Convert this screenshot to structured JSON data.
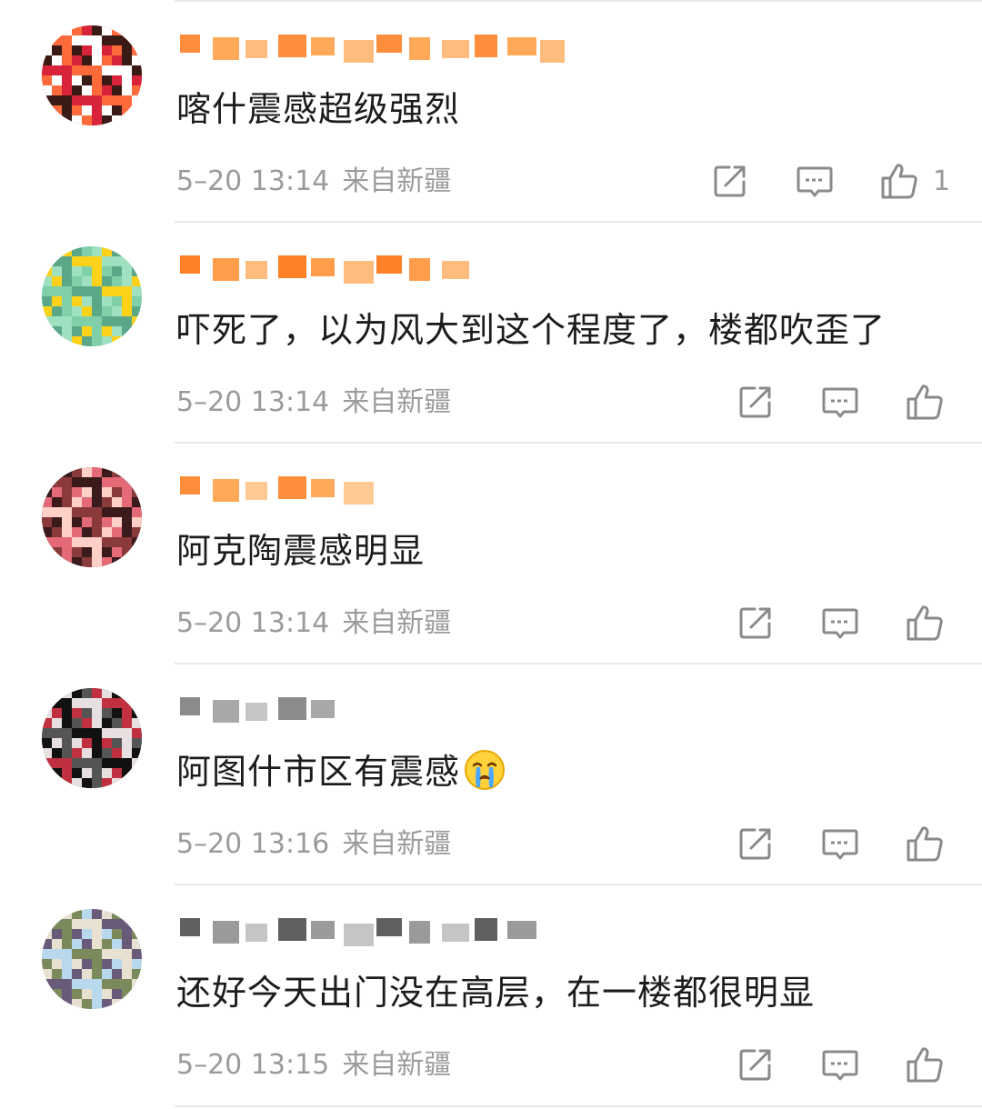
{
  "comments": [
    {
      "text": "喀什震感超级强烈",
      "time": "5-20 13:14",
      "source": "来自新疆",
      "likes": "1",
      "username_colors": [
        "#ff7a1a",
        "#ff9a3c",
        "#ffb066"
      ],
      "avatar_colors": [
        "#d8243a",
        "#ff6a3a",
        "#ffffff",
        "#3a1a14"
      ]
    },
    {
      "text": "吓死了，以为风大到这个程度了，楼都吹歪了",
      "time": "5-20 13:14",
      "source": "来自新疆",
      "likes": "",
      "username_colors": [
        "#ff6a00",
        "#ff8c2a",
        "#ffb066"
      ],
      "avatar_colors": [
        "#9fe0c0",
        "#7fcfa8",
        "#5aa888",
        "#ffd21a"
      ]
    },
    {
      "text": "阿克陶震感明显",
      "time": "5-20 13:14",
      "source": "来自新疆",
      "likes": "",
      "username_colors": [
        "#ff7a1a",
        "#ff9a3c",
        "#ffc080"
      ],
      "avatar_colors": [
        "#3a1a1a",
        "#e46a78",
        "#ffd0c8",
        "#8a3a3a"
      ]
    },
    {
      "text": "阿图什市区有震感",
      "emoji": "crying-face",
      "time": "5-20 13:16",
      "source": "来自新疆",
      "likes": "",
      "username_colors": [
        "#777777",
        "#999999",
        "#bbbbbb"
      ],
      "avatar_colors": [
        "#111111",
        "#e8e0e0",
        "#c03040",
        "#555555"
      ]
    },
    {
      "text": "还好今天出门没在高层，在一楼都很明显",
      "time": "5-20 13:15",
      "source": "来自新疆",
      "likes": "",
      "username_colors": [
        "#444444",
        "#888888",
        "#bbbbbb"
      ],
      "avatar_colors": [
        "#b8d8ee",
        "#7a8a5a",
        "#e8e0d0",
        "#6a5a7a"
      ]
    }
  ],
  "icons": {
    "share": "share-icon",
    "comment": "comment-icon",
    "like": "thumbs-up-icon"
  },
  "theme": {
    "text": "#1c1c1c",
    "meta": "#9b9b9b",
    "icon": "#8a8a8a",
    "divider": "#e9e9e9"
  }
}
